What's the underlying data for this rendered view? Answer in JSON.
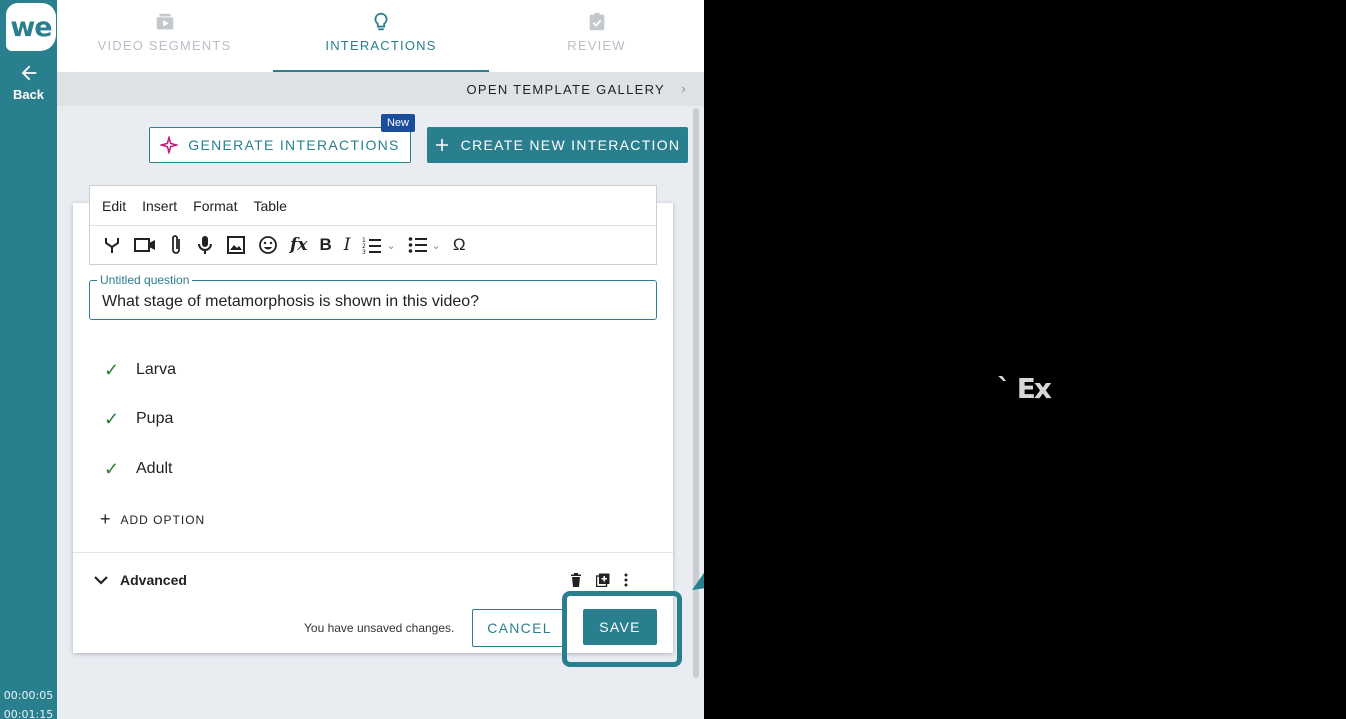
{
  "rail": {
    "logo_text": "we",
    "back_label": "Back",
    "timestamps": [
      "00:00:05",
      "00:01:15"
    ]
  },
  "tabs": [
    {
      "label": "VIDEO SEGMENTS",
      "icon": "video-segments-icon",
      "active": false
    },
    {
      "label": "INTERACTIONS",
      "icon": "lightbulb-icon",
      "active": true
    },
    {
      "label": "REVIEW",
      "icon": "clipboard-check-icon",
      "active": false
    }
  ],
  "gallery": {
    "label": "OPEN TEMPLATE GALLERY",
    "chevron": "›"
  },
  "actions": {
    "generate_label": "GENERATE INTERACTIONS",
    "new_badge": "New",
    "create_label": "CREATE NEW INTERACTION"
  },
  "editor": {
    "menus": [
      "Edit",
      "Insert",
      "Format",
      "Table"
    ],
    "toolbar": [
      "branch-icon",
      "video-icon",
      "paperclip-icon",
      "microphone-icon",
      "image-icon",
      "emoji-icon",
      "formula-icon",
      "bold-icon",
      "italic-icon",
      "numbered-list-icon",
      "bullet-list-icon",
      "omega-icon"
    ]
  },
  "question": {
    "legend": "Untitled question",
    "text": "What stage of metamorphosis is shown in this video?"
  },
  "options": [
    "Larva",
    "Pupa",
    "Adult"
  ],
  "add_option_label": "ADD OPTION",
  "advanced_label": "Advanced",
  "footer": {
    "unsaved_text": "You have unsaved changes.",
    "cancel_label": "CANCEL",
    "save_label": "SAVE"
  },
  "video": {
    "overlay_text": "` Ex"
  },
  "colors": {
    "accent": "#2a7f8f",
    "badge": "#1a4d9c",
    "check": "#2e7d32",
    "panel_bg": "#e9edf2"
  }
}
